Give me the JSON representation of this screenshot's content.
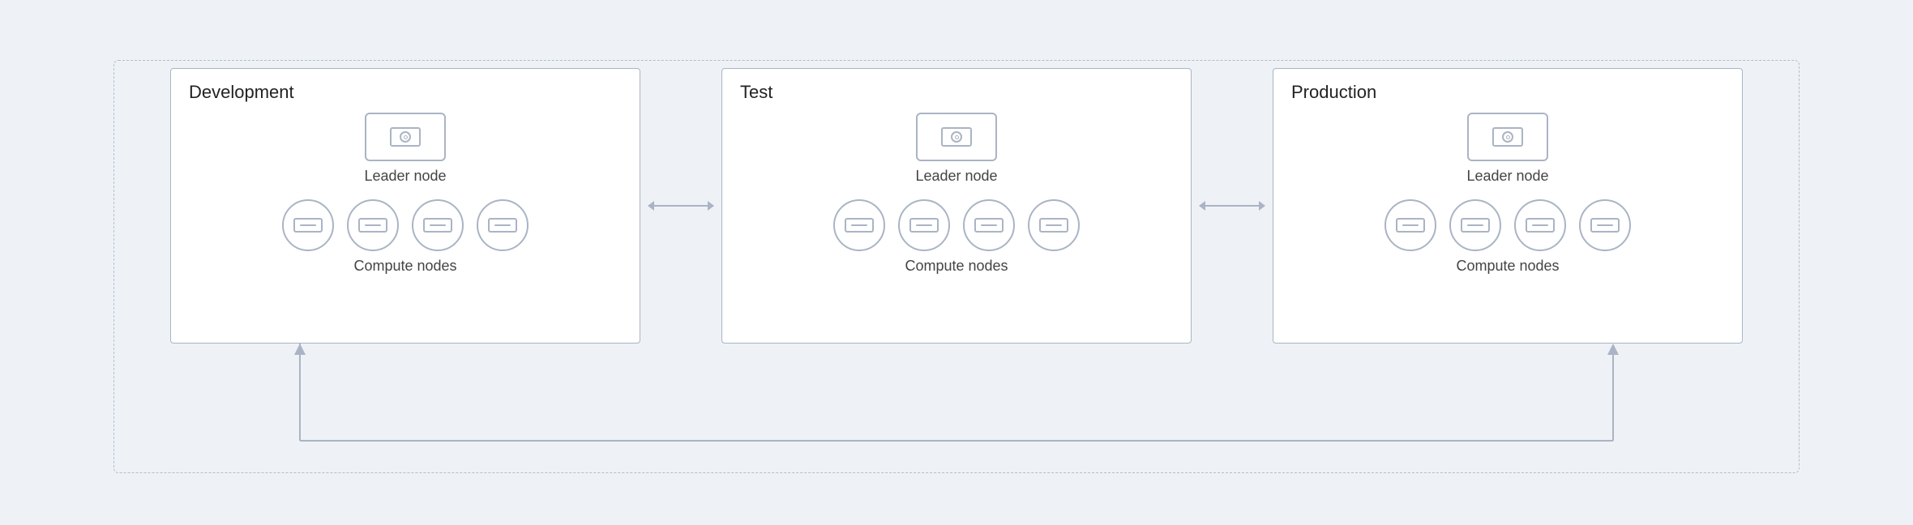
{
  "diagram": {
    "outer_border": "dashed",
    "clusters": [
      {
        "id": "development",
        "title": "Development",
        "leader_label": "Leader node",
        "compute_label": "Compute nodes",
        "compute_count": 4
      },
      {
        "id": "test",
        "title": "Test",
        "leader_label": "Leader node",
        "compute_label": "Compute nodes",
        "compute_count": 4
      },
      {
        "id": "production",
        "title": "Production",
        "leader_label": "Leader node",
        "compute_label": "Compute nodes",
        "compute_count": 4
      }
    ],
    "arrows_h": [
      "dev-to-test",
      "test-to-prod"
    ],
    "arrow_u": "dev-to-prod-bottom"
  }
}
